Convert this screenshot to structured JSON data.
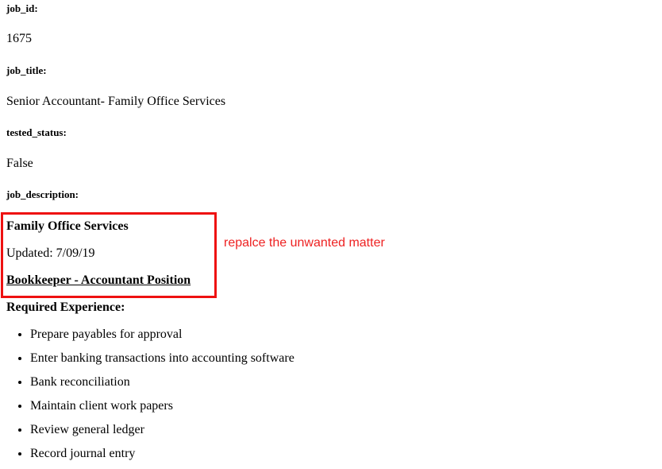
{
  "fields": {
    "job_id_label": "job_id:",
    "job_id_value": "1675",
    "job_title_label": "job_title:",
    "job_title_value": "Senior Accountant- Family Office Services",
    "tested_status_label": "tested_status:",
    "tested_status_value": "False",
    "job_description_label": "job_description:"
  },
  "description": {
    "company": "Family Office Services",
    "updated": "Updated: 7/09/19",
    "position": "Bookkeeper - Accountant Position",
    "required_heading": "Required Experience:",
    "items": [
      "Prepare payables for approval",
      "Enter banking transactions into accounting software",
      "Bank reconciliation",
      "Maintain client work papers",
      "Review general ledger",
      "Record journal entry"
    ]
  },
  "annotation": {
    "text": "repalce the unwanted matter",
    "color": "#ee2222"
  }
}
